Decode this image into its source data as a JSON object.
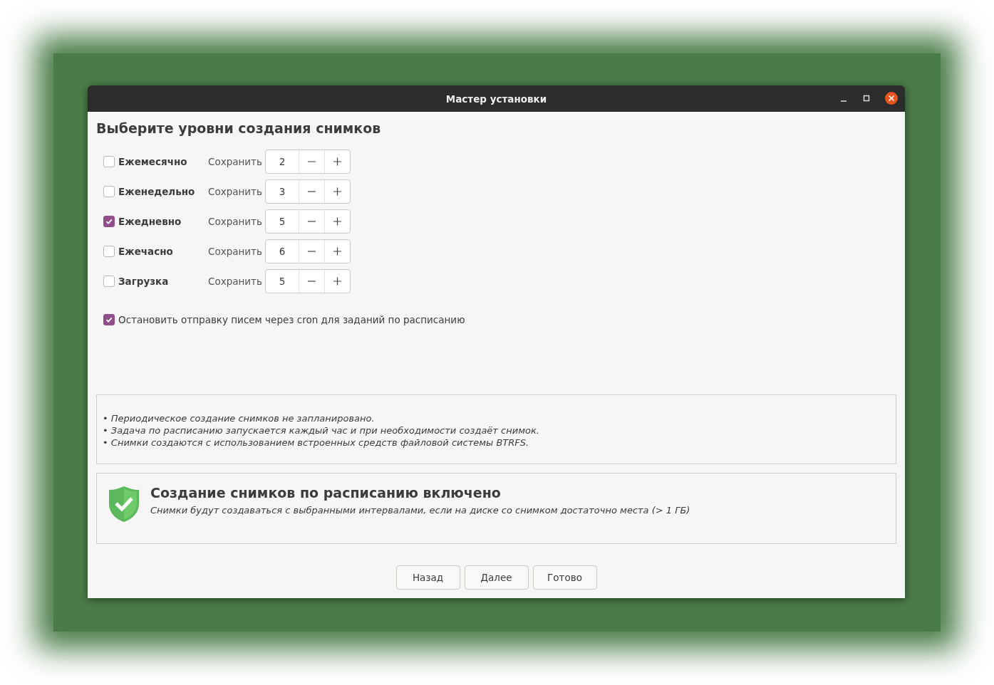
{
  "window": {
    "title": "Мастер установки"
  },
  "heading": "Выберите уровни создания снимков",
  "levels": [
    {
      "label": "Ежемесячно",
      "checked": false,
      "keep_label": "Сохранить",
      "value": "2"
    },
    {
      "label": "Еженедельно",
      "checked": false,
      "keep_label": "Сохранить",
      "value": "3"
    },
    {
      "label": "Ежедневно",
      "checked": true,
      "keep_label": "Сохранить",
      "value": "5"
    },
    {
      "label": "Ежечасно",
      "checked": false,
      "keep_label": "Сохранить",
      "value": "6"
    },
    {
      "label": "Загрузка",
      "checked": false,
      "keep_label": "Сохранить",
      "value": "5"
    }
  ],
  "cron_option": {
    "label": "Остановить отправку писем через cron для заданий по расписанию",
    "checked": true
  },
  "notes": [
    "• Периодическое создание снимков не запланировано.",
    "• Задача по расписанию запускается каждый час и при необходимости создаёт снимок.",
    "• Снимки создаются с использованием встроенных средств файловой системы BTRFS."
  ],
  "status": {
    "title": "Создание снимков по расписанию включено",
    "message": "Снимки будут создаваться с выбранными интервалами, если на диске со снимком достаточно места (> 1 ГБ)"
  },
  "buttons": [
    "Назад",
    "Далее",
    "Готово"
  ]
}
